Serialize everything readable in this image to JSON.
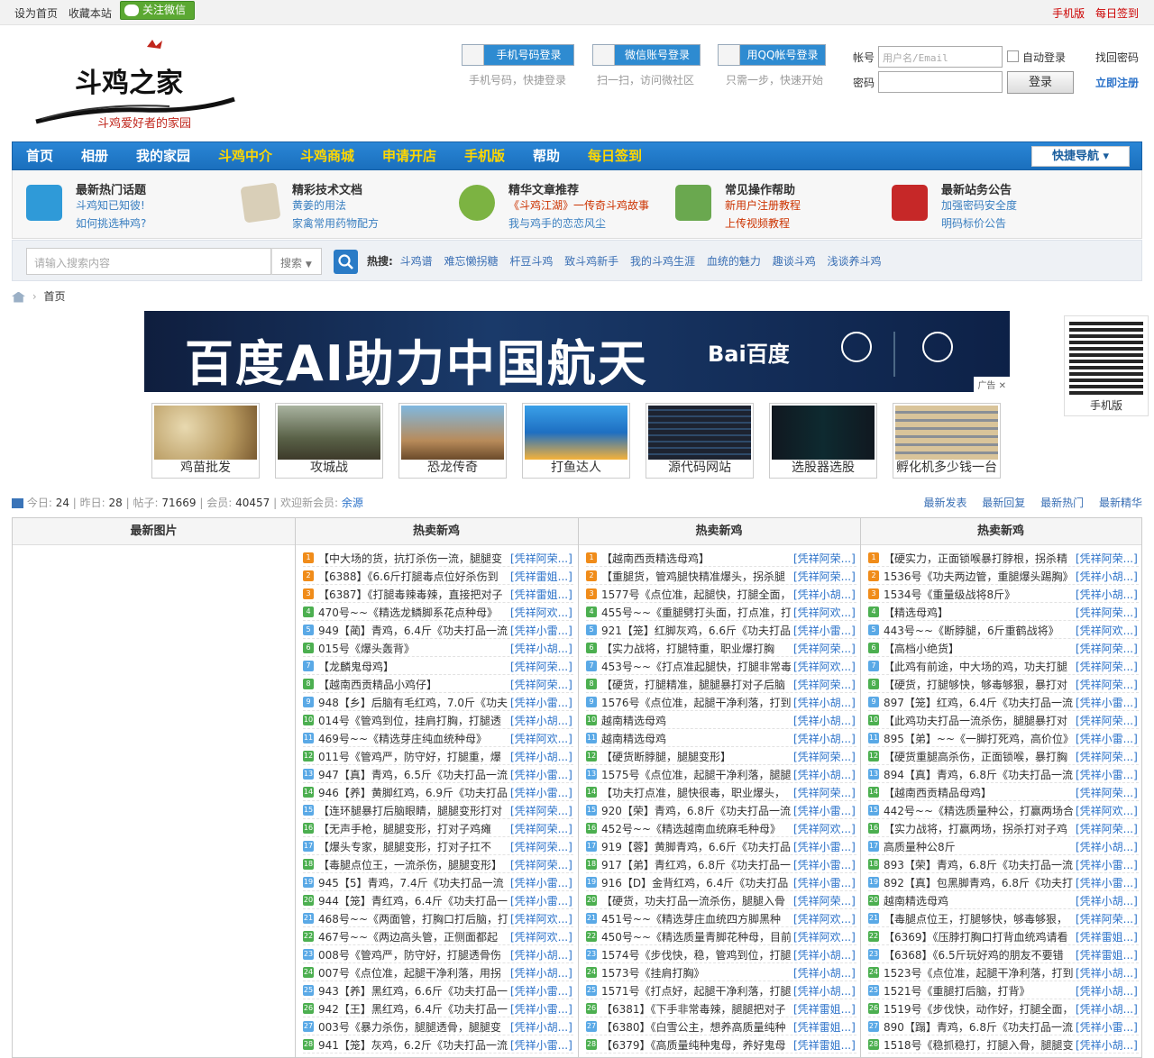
{
  "topbar": {
    "set_home": "设为首页",
    "favorite": "收藏本站",
    "follow_wechat": "关注微信",
    "mobile": "手机版",
    "daily_sign": "每日签到"
  },
  "logo": {
    "main": "斗鸡之家",
    "slogan": "斗鸡爱好者的家园"
  },
  "login": {
    "phone_btn": "手机号码登录",
    "phone_sub": "手机号码，快捷登录",
    "wechat_btn": "微信账号登录",
    "wechat_sub": "扫一扫，访问微社区",
    "qq_btn": "用QQ帐号登录",
    "qq_sub": "只需一步，快速开始",
    "account_label": "帐号",
    "account_placeholder": "用户名/Email",
    "password_label": "密码",
    "auto_login": "自动登录",
    "login_btn": "登录",
    "find_password": "找回密码",
    "register": "立即注册"
  },
  "nav": {
    "items": [
      "首页",
      "相册",
      "我的家园",
      "斗鸡中介",
      "斗鸡商城",
      "申请开店",
      "手机版",
      "帮助",
      "每日签到"
    ],
    "quick_nav": "快捷导航"
  },
  "info": [
    {
      "title": "最新热门话题",
      "l1": "斗鸡知已知彼!",
      "l2": "如何挑选种鸡?"
    },
    {
      "title": "精彩技术文档",
      "l1": "黄姜的用法",
      "l2": "家禽常用药物配方"
    },
    {
      "title": "精华文章推荐",
      "l1": "《斗鸡江湖》一传奇斗鸡故事",
      "l2": "我与鸡手的恋恋风尘"
    },
    {
      "title": "常见操作帮助",
      "l1": "新用户注册教程",
      "l2": "上传视频教程"
    },
    {
      "title": "最新站务公告",
      "l1": "加强密码安全度",
      "l2": "明码标价公告"
    }
  ],
  "search": {
    "placeholder": "请输入搜索内容",
    "type": "搜索",
    "hot_label": "热搜:",
    "hot_words": [
      "斗鸡谱",
      "难忘懒拐糖",
      "杆豆斗鸡",
      "致斗鸡新手",
      "我的斗鸡生涯",
      "血统的魅力",
      "趣谈斗鸡",
      "浅谈养斗鸡"
    ]
  },
  "breadcrumb": {
    "home": "首页"
  },
  "banner": {
    "text": "百度AI助力中国航天",
    "brand": "Bai百度",
    "ad": "广告"
  },
  "qr": {
    "label": "手机版"
  },
  "thumbs": [
    "鸡苗批发",
    "攻城战",
    "恐龙传奇",
    "打鱼达人",
    "源代码网站",
    "选股器选股",
    "孵化机多少钱一台"
  ],
  "stats": {
    "today_label": "今日:",
    "today": "24",
    "yesterday_label": "昨日:",
    "yesterday": "28",
    "posts_label": "帖子:",
    "posts": "71669",
    "members_label": "会员:",
    "members": "40457",
    "welcome_label": "欢迎新会员:",
    "new_member": "余源",
    "links": [
      "最新发表",
      "最新回复",
      "最新热门",
      "最新精华"
    ]
  },
  "columns": {
    "col0": "最新图片",
    "col1": "热卖新鸡",
    "col2": "热卖新鸡",
    "col3": "热卖新鸡"
  },
  "lists": {
    "c1": [
      [
        "【中大场的货，抗打杀伤一流，腿腿变",
        "[凭祥阿荣...]"
      ],
      [
        "【6388】《6.6斤打腿毒点位好杀伤到",
        "[凭祥雷姐...]"
      ],
      [
        "【6387】《打腿毒辣毒辣，直接把对子",
        "[凭祥雷姐...]"
      ],
      [
        "470号~~《精选龙鳞脚系花点种母》",
        "[凭祥阿欢...]"
      ],
      [
        "949【蔺】青鸡，6.4斤《功夫打品一流",
        "[凭祥小雷...]"
      ],
      [
        "015号《爆头轰背》",
        "[凭祥小胡...]"
      ],
      [
        "【龙麟鬼母鸡】",
        "[凭祥阿荣...]"
      ],
      [
        "【越南西贡精品小鸡仔】",
        "[凭祥阿荣...]"
      ],
      [
        "948【乡】后脑有毛红鸡，7.0斤《功夫",
        "[凭祥小雷...]"
      ],
      [
        "014号《管鸡到位，挂肩打胸，打腿透",
        "[凭祥小胡...]"
      ],
      [
        "469号~~《精选芽庄纯血统种母》",
        "[凭祥阿欢...]"
      ],
      [
        "011号《管鸡严，防守好，打腿重，爆",
        "[凭祥小胡...]"
      ],
      [
        "947【真】青鸡，6.5斤《功夫打品一流",
        "[凭祥小雷...]"
      ],
      [
        "946【养】黄脚红鸡，6.9斤《功夫打品",
        "[凭祥小雷...]"
      ],
      [
        "【连环腿暴打后脑眼睛，腿腿变形打对",
        "[凭祥阿荣...]"
      ],
      [
        "【无声手枪，腿腿变形，打对子鸡瘫",
        "[凭祥阿荣...]"
      ],
      [
        "【爆头专家，腿腿变形，打对子扛不",
        "[凭祥阿荣...]"
      ],
      [
        "【毒腿点位王，一流杀伤，腿腿变形】",
        "[凭祥阿荣...]"
      ],
      [
        "945【5】青鸡，7.4斤《功夫打品一流",
        "[凭祥小雷...]"
      ],
      [
        "944【笼】青红鸡，6.4斤《功夫打品一",
        "[凭祥小雷...]"
      ],
      [
        "468号~~《两面管，打胸口打后脑，打",
        "[凭祥阿欢...]"
      ],
      [
        "467号~~《两边高头管，正侧面都起",
        "[凭祥阿欢...]"
      ],
      [
        "008号《管鸡严，防守好，打腿透骨伤",
        "[凭祥小胡...]"
      ],
      [
        "007号《点位准，起腿干净利落，用拐",
        "[凭祥小胡...]"
      ],
      [
        "943【养】黑红鸡，6.6斤《功夫打品一",
        "[凭祥小雷...]"
      ],
      [
        "942【王】黑红鸡，6.4斤《功夫打品一",
        "[凭祥小雷...]"
      ],
      [
        "003号《暴力杀伤，腿腿透骨，腿腿变",
        "[凭祥小胡...]"
      ],
      [
        "941【笼】灰鸡，6.2斤《功夫打品一流",
        "[凭祥小雷...]"
      ]
    ],
    "c2": [
      [
        "【越南西贡精选母鸡】",
        "[凭祥阿荣...]"
      ],
      [
        "【重腿货，管鸡腿快精准爆头，拐杀腿",
        "[凭祥阿荣...]"
      ],
      [
        "1577号《点位准，起腿快，打腿全面，",
        "[凭祥小胡...]"
      ],
      [
        "455号~~《重腿劈打头面，打点准，打",
        "[凭祥阿欢...]"
      ],
      [
        "921【笼】红脚灰鸡，6.6斤《功夫打品",
        "[凭祥小雷...]"
      ],
      [
        "【实力战将，打腿特重，职业爆打胸",
        "[凭祥阿荣...]"
      ],
      [
        "453号~~《打点准起腿快，打腿非常毒",
        "[凭祥阿欢...]"
      ],
      [
        "【硬货，打腿精准，腿腿暴打对子后脑",
        "[凭祥阿荣...]"
      ],
      [
        "1576号《点位准，起腿干净利落，打到",
        "[凭祥小胡...]"
      ],
      [
        "越南精选母鸡",
        "[凭祥小胡...]"
      ],
      [
        "越南精选母鸡",
        "[凭祥小胡...]"
      ],
      [
        "【硬货断脖腿，腿腿变形】",
        "[凭祥阿荣...]"
      ],
      [
        "1575号《点位准，起腿干净利落，腿腿",
        "[凭祥小胡...]"
      ],
      [
        "【功夫打点准，腿快很毒，职业爆头，",
        "[凭祥阿荣...]"
      ],
      [
        "920【荣】青鸡，6.8斤《功夫打品一流",
        "[凭祥小雷...]"
      ],
      [
        "452号~~《精选越南血统麻毛种母》",
        "[凭祥阿欢...]"
      ],
      [
        "919【蓉】黄脚青鸡，6.6斤《功夫打品",
        "[凭祥小雷...]"
      ],
      [
        "917【弟】青红鸡，6.8斤《功夫打品一",
        "[凭祥小雷...]"
      ],
      [
        "916【D】金背红鸡，6.4斤《功夫打品",
        "[凭祥小雷...]"
      ],
      [
        "【硬货，功夫打品一流杀伤，腿腿入骨",
        "[凭祥阿荣...]"
      ],
      [
        "451号~~《精选芽庄血统四方脚黑种",
        "[凭祥阿欢...]"
      ],
      [
        "450号~~《精选质量青脚花种母，目前",
        "[凭祥阿欢...]"
      ],
      [
        "1574号《步伐快，稳，管鸡到位，打腿",
        "[凭祥小胡...]"
      ],
      [
        "1573号《挂肩打胸》",
        "[凭祥小胡...]"
      ],
      [
        "1571号《打点好，起腿干净利落，打腿",
        "[凭祥小胡...]"
      ],
      [
        "【6381】《下手非常毒辣，腿腿把对子",
        "[凭祥雷姐...]"
      ],
      [
        "【6380】《白雪公主，想养高质量纯种",
        "[凭祥雷姐...]"
      ],
      [
        "【6379】《高质量纯种鬼母，养好鬼母",
        "[凭祥雷姐...]"
      ]
    ],
    "c3": [
      [
        "【硬实力，正面锁喉暴打脖根，拐杀精",
        "[凭祥阿荣...]"
      ],
      [
        "1536号《功夫两边管，重腿爆头踢胸》",
        "[凭祥小胡...]"
      ],
      [
        "1534号《重量级战将8斤》",
        "[凭祥小胡...]"
      ],
      [
        "【精选母鸡】",
        "[凭祥阿荣...]"
      ],
      [
        "443号~~《断脖腿，6斤重鹤战将》",
        "[凭祥阿欢...]"
      ],
      [
        "【高档小绝货】",
        "[凭祥阿荣...]"
      ],
      [
        "【此鸡有前途，中大场的鸡，功夫打腿",
        "[凭祥阿荣...]"
      ],
      [
        "【硬货，打腿够快，够毒够狠，暴打对",
        "[凭祥阿荣...]"
      ],
      [
        "897【笼】红鸡，6.4斤《功夫打品一流",
        "[凭祥小雷...]"
      ],
      [
        "【此鸡功夫打品一流杀伤，腿腿暴打对",
        "[凭祥阿荣...]"
      ],
      [
        "895【弟】~~《一脚打死鸡，高价位》青",
        "[凭祥小雷...]"
      ],
      [
        "【硬货重腿高杀伤，正面锁喉，暴打胸",
        "[凭祥阿荣...]"
      ],
      [
        "894【真】青鸡，6.8斤《功夫打品一流",
        "[凭祥小雷...]"
      ],
      [
        "【越南西贡精品母鸡】",
        "[凭祥阿荣...]"
      ],
      [
        "442号~~《精选质量种公，打赢两场合",
        "[凭祥阿欢...]"
      ],
      [
        "【实力战将，打赢两场，拐杀打对子鸡",
        "[凭祥阿荣...]"
      ],
      [
        "高质量种公8斤",
        "[凭祥小胡...]"
      ],
      [
        "893【荣】青鸡，6.8斤《功夫打品一流",
        "[凭祥小雷...]"
      ],
      [
        "892【真】包黑脚青鸡，6.8斤《功夫打",
        "[凭祥小雷...]"
      ],
      [
        "越南精选母鸡",
        "[凭祥小胡...]"
      ],
      [
        "【毒腿点位王，打腿够快，够毒够狠，",
        "[凭祥阿荣...]"
      ],
      [
        "【6369】《压脖打胸口打背血统鸡请看",
        "[凭祥雷姐...]"
      ],
      [
        "【6368】《6.5斤玩好鸡的朋友不要错",
        "[凭祥雷姐...]"
      ],
      [
        "1523号《点位准，起腿干净利落，打到",
        "[凭祥小胡...]"
      ],
      [
        "1521号《重腿打后脑，打背》",
        "[凭祥小胡...]"
      ],
      [
        "1519号《步伐快，动作好，打腿全面，",
        "[凭祥小胡...]"
      ],
      [
        "890【蹋】青鸡，6.8斤《功夫打品一流",
        "[凭祥小雷...]"
      ],
      [
        "1518号《稳抓稳打，打腿入骨，腿腿变",
        "[凭祥小胡...]"
      ]
    ]
  },
  "colors": {
    "nav_bg": "#1f79c9",
    "link": "#2b72c9",
    "accent_red": "#cc0000"
  }
}
